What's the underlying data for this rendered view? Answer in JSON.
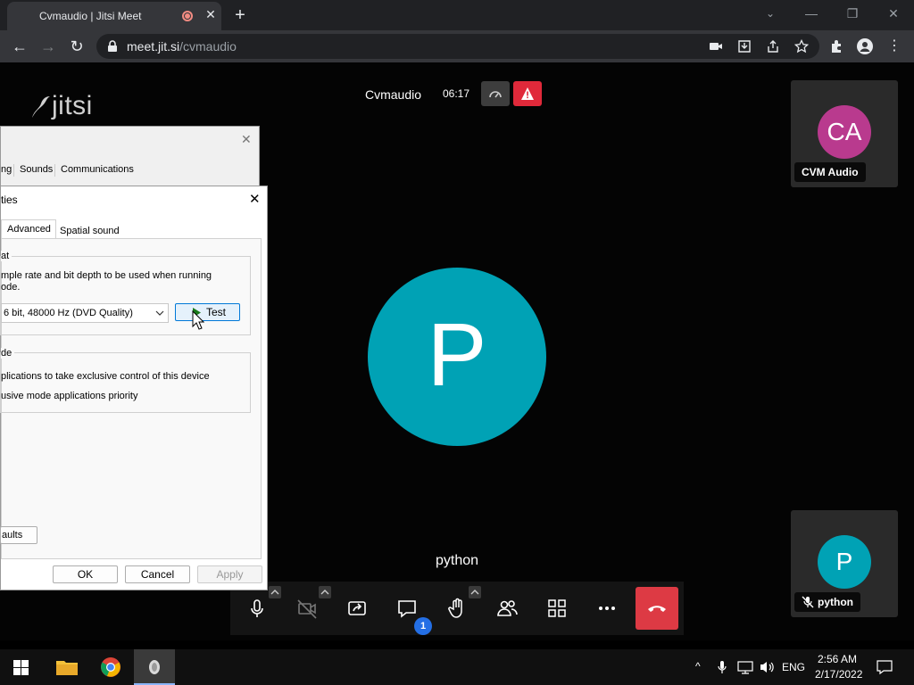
{
  "browser": {
    "tab_title": "Cvmaudio | Jitsi Meet",
    "url_host": "meet.jit.si",
    "url_path": "/cvmaudio",
    "new_tab_label": "+"
  },
  "jitsi": {
    "logo": "jitsi",
    "meeting_name": "Cvmaudio",
    "timer": "06:17",
    "dominant_avatar_letter": "P",
    "dominant_name": "python",
    "participants": [
      {
        "initials": "CA",
        "name": "CVM Audio",
        "color": "#b93a8e"
      },
      {
        "initials": "P",
        "name": "python",
        "color": "#00a2b5"
      }
    ],
    "chat_unread": "1"
  },
  "sound_dialog": {
    "tabs": [
      "ng",
      "Sounds",
      "Communications"
    ]
  },
  "props_dialog": {
    "title": "ties",
    "tabs": [
      "Advanced",
      "Spatial sound"
    ],
    "format_group": "at",
    "format_desc_1": "mple rate and bit depth to be used when running",
    "format_desc_2": "ode.",
    "format_value": "6 bit, 48000 Hz (DVD Quality)",
    "test_label": "Test",
    "exclusive_group": "de",
    "exclusive_1": "plications to take exclusive control of this device",
    "exclusive_2": "usive mode applications priority",
    "defaults_label": "aults",
    "ok_label": "OK",
    "cancel_label": "Cancel",
    "apply_label": "Apply"
  },
  "taskbar": {
    "lang": "ENG",
    "time": "2:56 AM",
    "date": "2/17/2022"
  }
}
